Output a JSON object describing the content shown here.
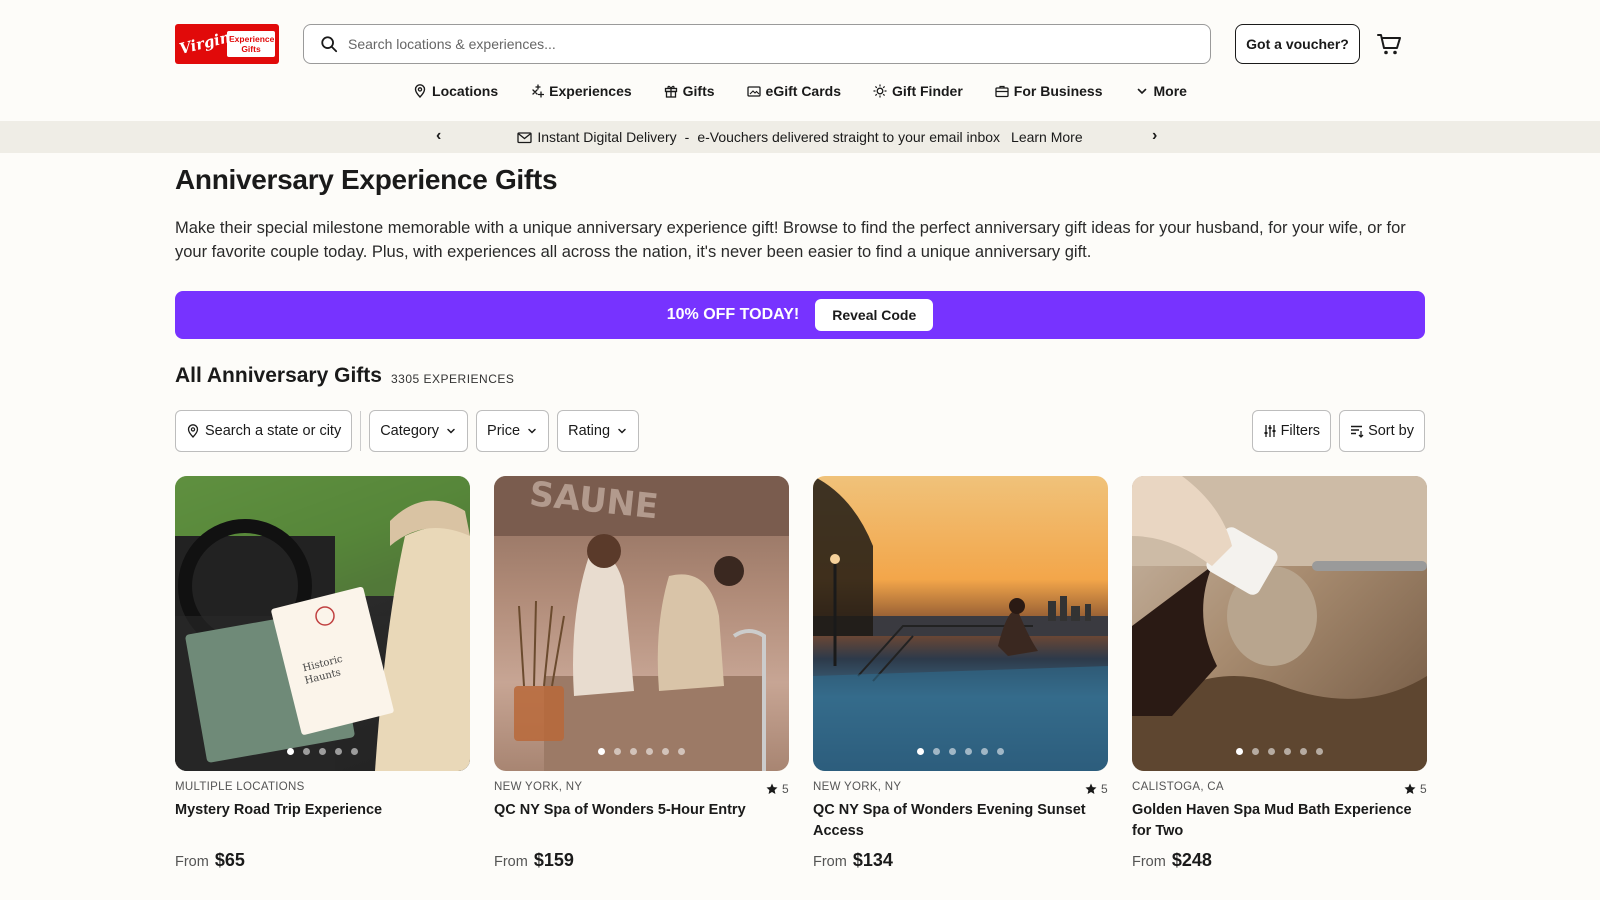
{
  "header": {
    "logo_text": "Virgin",
    "logo_sub": "Experience Gifts",
    "search_placeholder": "Search locations & experiences...",
    "voucher_label": "Got a voucher?"
  },
  "nav": [
    {
      "label": "Locations",
      "icon": "location-pin-icon"
    },
    {
      "label": "Experiences",
      "icon": "sparkle-icon"
    },
    {
      "label": "Gifts",
      "icon": "gift-icon"
    },
    {
      "label": "eGift Cards",
      "icon": "card-icon"
    },
    {
      "label": "Gift Finder",
      "icon": "sun-icon"
    },
    {
      "label": "For Business",
      "icon": "briefcase-icon"
    },
    {
      "label": "More",
      "icon": "chevron-down-icon"
    }
  ],
  "strip": {
    "title": "Instant Digital Delivery",
    "separator": "-",
    "text": "e-Vouchers delivered straight to your email inbox",
    "link": "Learn More"
  },
  "page": {
    "title": "Anniversary Experience Gifts",
    "description": "Make their special milestone memorable with a unique anniversary experience gift! Browse to find the perfect anniversary gift ideas for your husband, for your wife, or for your favorite couple today. Plus, with experiences all across the nation, it's never been easier to find a unique anniversary gift."
  },
  "banner": {
    "offer": "10% OFF TODAY!",
    "button": "Reveal Code",
    "color": "#7733ff"
  },
  "listing": {
    "title": "All Anniversary Gifts",
    "count": "3305 EXPERIENCES",
    "filters": {
      "location": "Search a state or city",
      "category": "Category",
      "price": "Price",
      "rating": "Rating",
      "filters": "Filters",
      "sort": "Sort by"
    }
  },
  "cards": [
    {
      "location": "MULTIPLE LOCATIONS",
      "name": "Mystery Road Trip Experience",
      "rating": "",
      "from": "From",
      "price": "$65",
      "image": "woman reading road trip booklet in car"
    },
    {
      "location": "NEW YORK, NY",
      "name": "QC NY Spa of Wonders 5-Hour Entry",
      "rating": "5",
      "from": "From",
      "price": "$159",
      "image": "two women relaxing in spa"
    },
    {
      "location": "NEW YORK, NY",
      "name": "QC NY Spa of Wonders Evening Sunset Access",
      "rating": "5",
      "from": "From",
      "price": "$134",
      "image": "woman in pool at sunset with city skyline"
    },
    {
      "location": "CALISTOGA, CA",
      "name": "Golden Haven Spa Mud Bath Experience for Two",
      "rating": "5",
      "from": "From",
      "price": "$248",
      "image": "woman in mud bath with towel"
    }
  ]
}
